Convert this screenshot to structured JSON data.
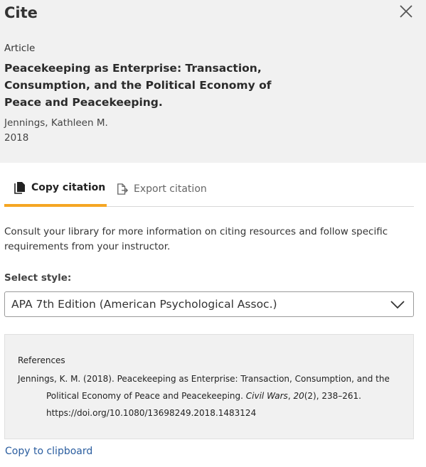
{
  "modal": {
    "title": "Cite",
    "close_icon": "close-icon"
  },
  "item": {
    "type": "Article",
    "title": "Peacekeeping as Enterprise: Transaction, Consumption, and the Political Economy of Peace and Peacekeeping.",
    "author": "Jennings, Kathleen M.",
    "year": "2018"
  },
  "tabs": [
    {
      "label": "Copy citation",
      "icon": "document-copy-icon",
      "active": true
    },
    {
      "label": "Export citation",
      "icon": "file-export-icon",
      "active": false
    }
  ],
  "info_text": "Consult your library for more information on citing resources and follow specific requirements from your instructor.",
  "style_select": {
    "label": "Select style:",
    "selected": "APA 7th Edition (American Psychological Assoc.)",
    "icon": "chevron-down-icon"
  },
  "citation": {
    "heading": "References",
    "prefix": "Jennings, K. M. (2018). Peacekeeping as Enterprise: Transaction, Consumption, and the Political Economy of Peace and Peacekeeping. ",
    "journal": "Civil Wars",
    "sep": ", ",
    "volume": "20",
    "issue_pages": "(2), 238–261.",
    "doi": "https://doi.org/10.1080/13698249.2018.1483124"
  },
  "copy_link": "Copy to clipboard",
  "colors": {
    "accent": "#f5a623",
    "link": "#2a5d9f",
    "panel": "#f1f1f1"
  }
}
